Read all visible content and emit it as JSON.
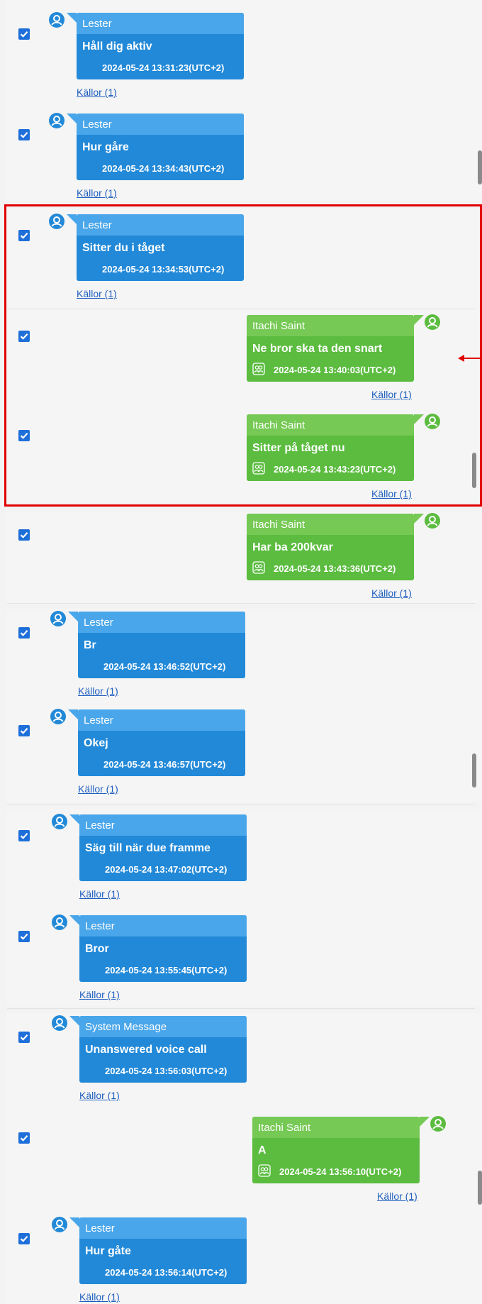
{
  "messages": [
    {
      "sender": "Lester",
      "text": "Håll dig aktiv",
      "timestamp": "2024-05-24 13:31:23(UTC+2)",
      "sources": "Källor (1)",
      "side": "left"
    },
    {
      "sender": "Lester",
      "text": "Hur gåre",
      "timestamp": "2024-05-24 13:34:43(UTC+2)",
      "sources": "Källor (1)",
      "side": "left"
    },
    {
      "sender": "Lester",
      "text": "Sitter du i tåget",
      "timestamp": "2024-05-24 13:34:53(UTC+2)",
      "sources": "Källor (1)",
      "side": "left"
    },
    {
      "sender": "Itachi Saint",
      "text": "Ne bror ska ta den snart",
      "timestamp": "2024-05-24 13:40:03(UTC+2)",
      "sources": "Källor (1)",
      "side": "right"
    },
    {
      "sender": "Itachi Saint",
      "text": "Sitter på tåget nu",
      "timestamp": "2024-05-24 13:43:23(UTC+2)",
      "sources": "Källor (1)",
      "side": "right"
    },
    {
      "sender": "Itachi Saint",
      "text": "Har ba 200kvar",
      "timestamp": "2024-05-24 13:43:36(UTC+2)",
      "sources": "Källor (1)",
      "side": "right"
    },
    {
      "sender": "Lester",
      "text": "Br",
      "timestamp": "2024-05-24 13:46:52(UTC+2)",
      "sources": "Källor (1)",
      "side": "left"
    },
    {
      "sender": "Lester",
      "text": "Okej",
      "timestamp": "2024-05-24 13:46:57(UTC+2)",
      "sources": "Källor (1)",
      "side": "left"
    },
    {
      "sender": "Lester",
      "text": "Säg till när due framme",
      "timestamp": "2024-05-24 13:47:02(UTC+2)",
      "sources": "Källor (1)",
      "side": "left"
    },
    {
      "sender": "Lester",
      "text": "Bror",
      "timestamp": "2024-05-24 13:55:45(UTC+2)",
      "sources": "Källor (1)",
      "side": "left"
    },
    {
      "sender": "System Message",
      "text": "Unanswered voice call",
      "timestamp": "2024-05-24 13:56:03(UTC+2)",
      "sources": "Källor (1)",
      "side": "left"
    },
    {
      "sender": "Itachi Saint",
      "text": "A",
      "timestamp": "2024-05-24 13:56:10(UTC+2)",
      "sources": "Källor (1)",
      "side": "right"
    },
    {
      "sender": "Lester",
      "text": "Hur gåte",
      "timestamp": "2024-05-24 13:56:14(UTC+2)",
      "sources": "Källor (1)",
      "side": "left"
    }
  ],
  "colors": {
    "incoming_bubble": "#2289d8",
    "incoming_header": "#4aa6ea",
    "outgoing_bubble": "#5bbc3f",
    "outgoing_header": "#75c954",
    "highlight_box": "#e10000",
    "checkbox": "#1e6fd9"
  },
  "icons": {
    "avatar": "user-avatar-icon",
    "checkbox": "checkbox-checked-icon",
    "call": "contacts-icon",
    "annotation": "red-arrow-icon"
  }
}
